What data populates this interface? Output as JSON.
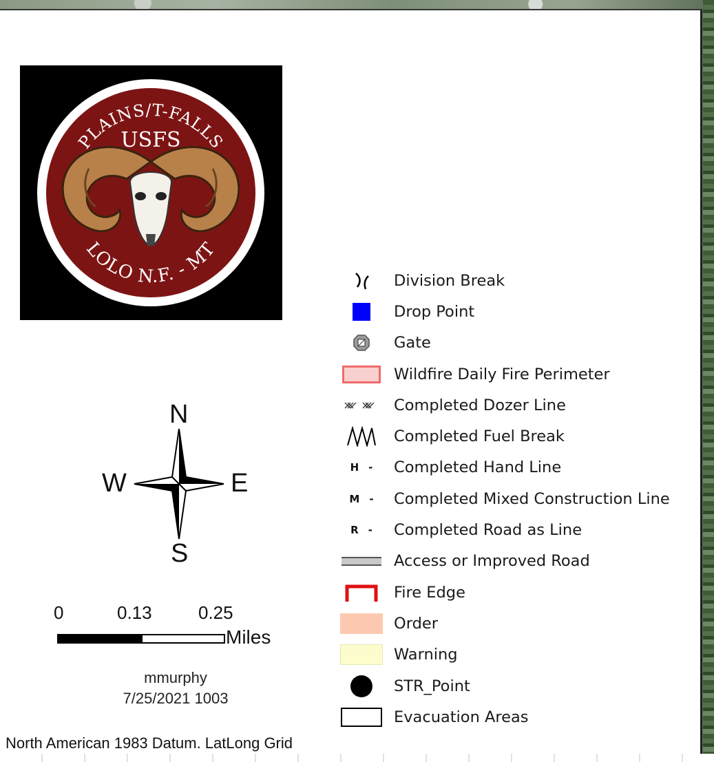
{
  "logo": {
    "top_text": "PLAINS/T-FALLS",
    "middle_text": "USFS",
    "bottom_text": "LOLO N.F. - MT",
    "ring_color": "#7d1414",
    "background": "#000000"
  },
  "north_arrow": {
    "n": "N",
    "s": "S",
    "e": "E",
    "w": "W"
  },
  "scale_bar": {
    "ticks": [
      "0",
      "0.13",
      "0.25"
    ],
    "units": "Miles"
  },
  "author": {
    "name": "mmurphy",
    "datetime": "7/25/2021 1003"
  },
  "datum": "North American 1983 Datum. LatLong Grid",
  "legend": {
    "items": [
      {
        "label": "Division Break",
        "symbol": "division-break-icon"
      },
      {
        "label": "Drop Point",
        "symbol": "blue-square-icon",
        "color": "#0000ff"
      },
      {
        "label": "Gate",
        "symbol": "gate-icon"
      },
      {
        "label": "Wildfire Daily Fire Perimeter",
        "symbol": "perimeter-icon",
        "color": "#f08080"
      },
      {
        "label": "Completed Dozer Line",
        "symbol": "dozer-line-icon"
      },
      {
        "label": "Completed Fuel Break",
        "symbol": "fuel-break-icon"
      },
      {
        "label": "Completed Hand Line",
        "symbol": "hand-line-icon",
        "letter": "H"
      },
      {
        "label": "Completed Mixed Construction Line",
        "symbol": "mixed-line-icon",
        "letter": "M"
      },
      {
        "label": "Completed Road as Line",
        "symbol": "road-line-icon",
        "letter": "R"
      },
      {
        "label": "Access or Improved Road",
        "symbol": "road-icon"
      },
      {
        "label": "Fire Edge",
        "symbol": "fire-edge-icon",
        "color": "#e01010"
      },
      {
        "label": "Order",
        "symbol": "order-swatch-icon",
        "color": "#fcc9b0"
      },
      {
        "label": "Warning",
        "symbol": "warning-swatch-icon",
        "color": "#fdfccc"
      },
      {
        "label": "STR_Point",
        "symbol": "black-dot-icon"
      },
      {
        "label": "Evacuation Areas",
        "symbol": "evac-box-icon"
      }
    ]
  }
}
